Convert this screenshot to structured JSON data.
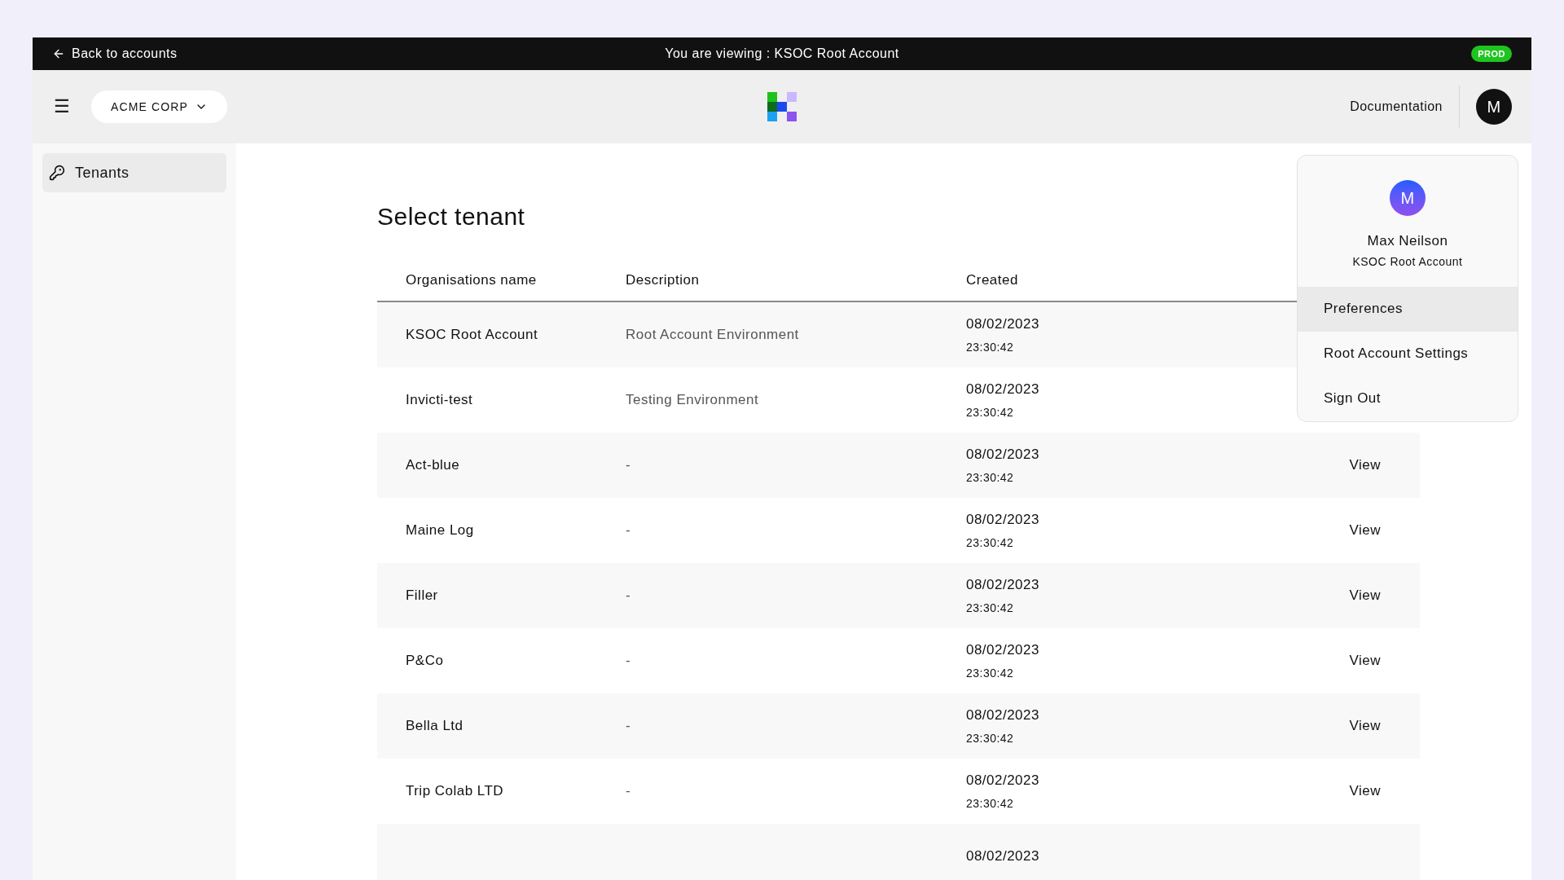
{
  "top_bar": {
    "back_link": "Back to accounts",
    "viewing": "You are viewing : KSOC Root Account",
    "environment_badge": "PROD"
  },
  "header": {
    "menu_icon": "☰",
    "account_selector": "ACME CORP",
    "documentation_link": "Documentation",
    "avatar": "M"
  },
  "sidebar": {
    "items": [
      {
        "label": "Tenants",
        "selected": true
      }
    ]
  },
  "page_title": "Select tenant",
  "table": {
    "columns": [
      "Organisations name",
      "Description",
      "Created"
    ],
    "rows": [
      {
        "name": "KSOC Root Account",
        "description": "Root Account Environment",
        "date": "08/02/2023",
        "time": "23:30:42"
      },
      {
        "name": "Invicti-test",
        "description": "Testing Environment",
        "date": "08/02/2023",
        "time": "23:30:42"
      },
      {
        "name": "Act-blue",
        "description": "-",
        "date": "08/02/2023",
        "time": "23:30:42",
        "action": "View"
      },
      {
        "name": "Maine Log",
        "description": "-",
        "date": "08/02/2023",
        "time": "23:30:42",
        "action": "View"
      },
      {
        "name": "Filler",
        "description": "-",
        "date": "08/02/2023",
        "time": "23:30:42",
        "action": "View"
      },
      {
        "name": "P&Co",
        "description": "-",
        "date": "08/02/2023",
        "time": "23:30:42",
        "action": "View"
      },
      {
        "name": "Bella Ltd",
        "description": "-",
        "date": "08/02/2023",
        "time": "23:30:42",
        "action": "View"
      },
      {
        "name": "Trip Colab LTD",
        "description": "-",
        "date": "08/02/2023",
        "time": "23:30:42",
        "action": "View"
      },
      {
        "date": "08/02/2023"
      }
    ]
  },
  "user_menu": {
    "avatar": "M",
    "name": "Max Neilson",
    "account": "KSOC Root Account",
    "items": [
      {
        "label": "Preferences",
        "selected": true
      },
      {
        "label": "Root Account Settings",
        "selected": false
      },
      {
        "label": "Sign Out",
        "selected": false
      }
    ]
  }
}
